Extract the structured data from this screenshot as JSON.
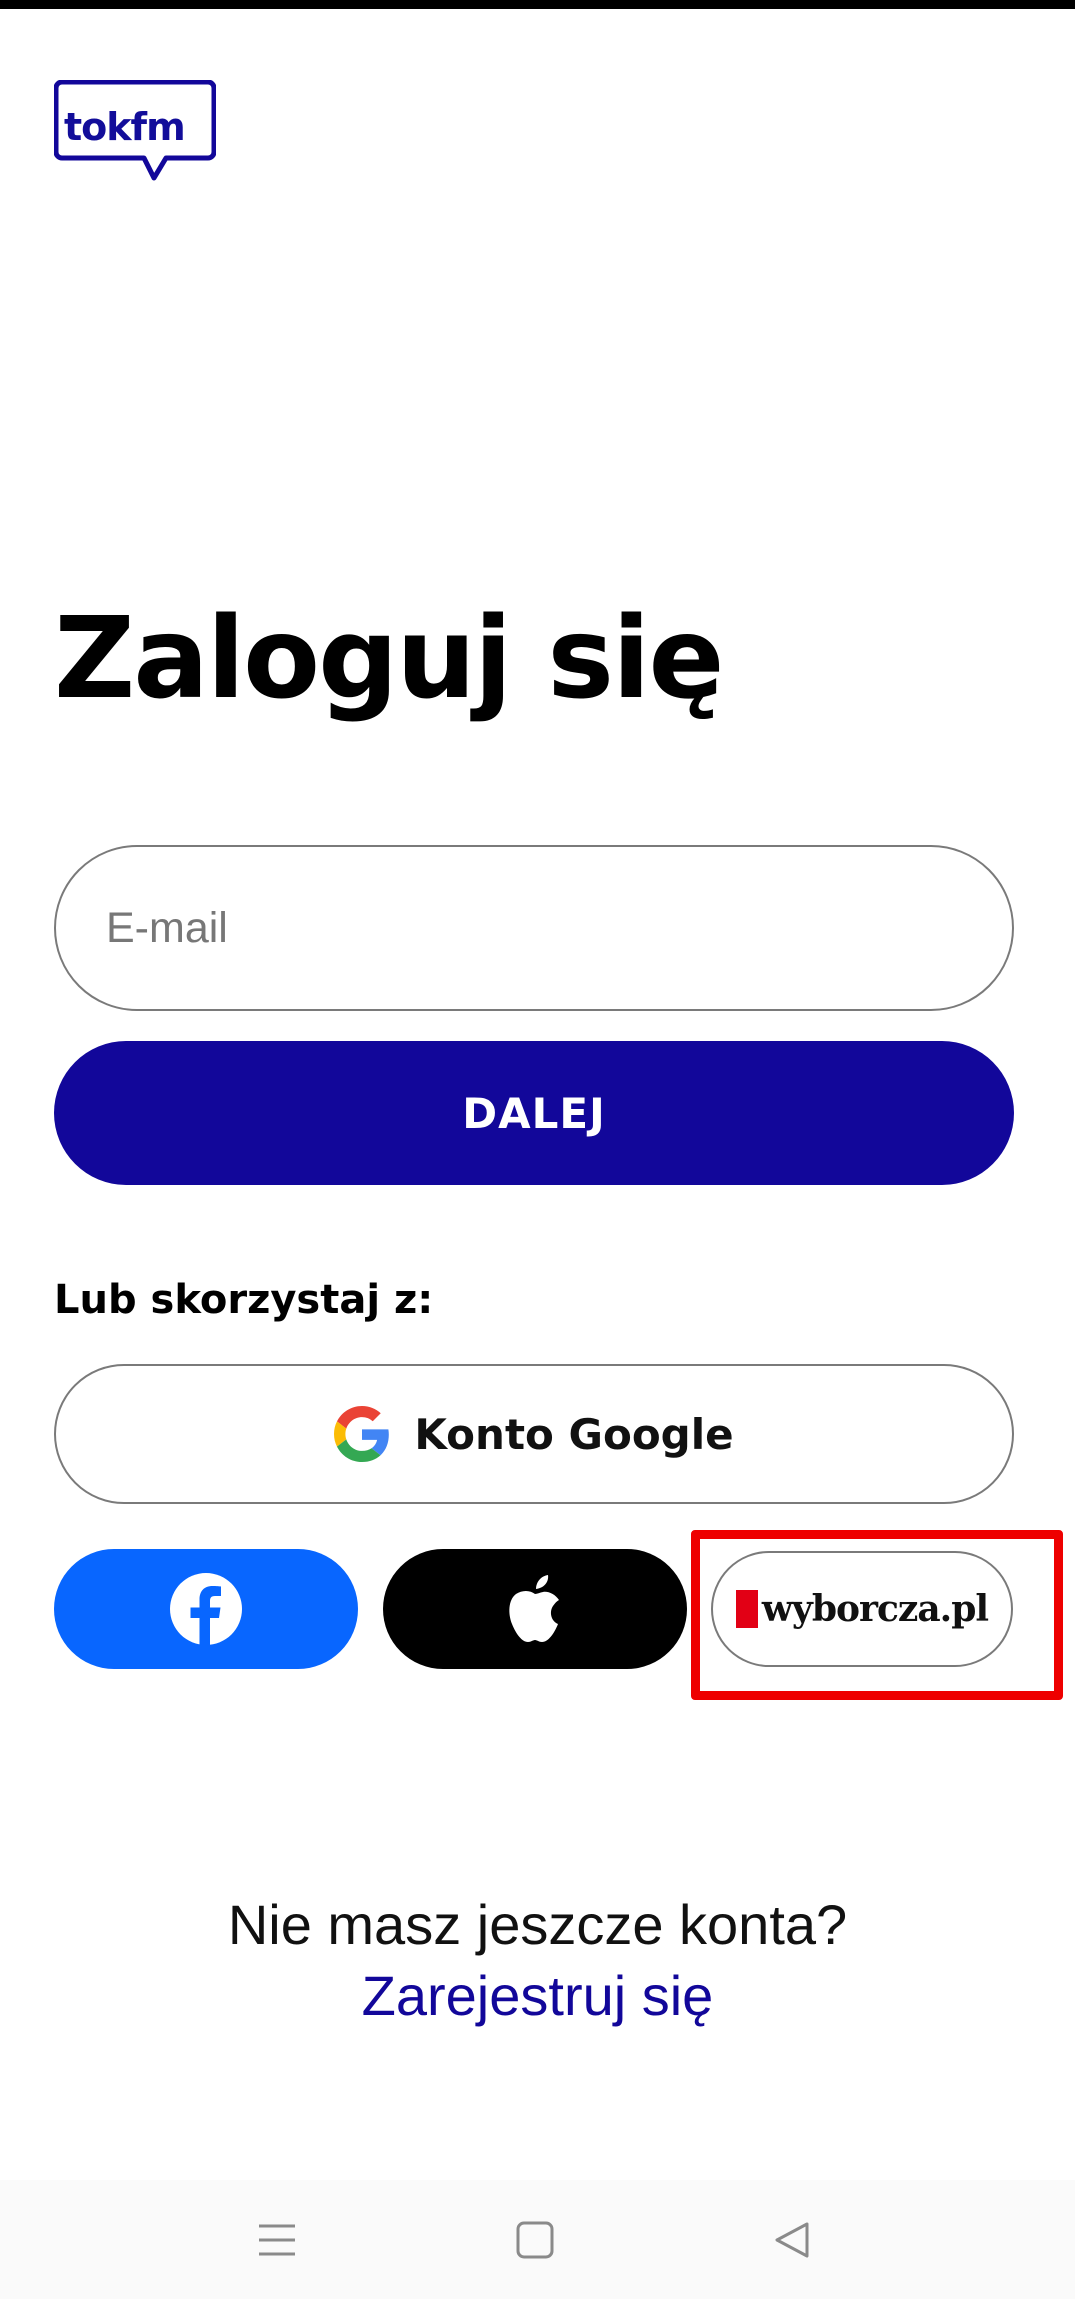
{
  "logo": {
    "text": "tokfm"
  },
  "page": {
    "title": "Zaloguj się"
  },
  "email": {
    "placeholder": "E-mail",
    "value": ""
  },
  "primary_button": {
    "label": "DALEJ"
  },
  "alternatives": {
    "label": "Lub skorzystaj z:",
    "google_label": "Konto Google",
    "wyborcza_label": "wyborcza.pl"
  },
  "signup": {
    "question": "Nie masz jeszcze konta?",
    "link": "Zarejestruj się"
  },
  "icons": {
    "google": "google-icon",
    "facebook": "facebook-icon",
    "apple": "apple-icon",
    "nav_menu": "menu-icon",
    "nav_home": "home-icon",
    "nav_back": "back-icon"
  },
  "colors": {
    "brand": "#12079a",
    "facebook": "#0866ff",
    "apple": "#000000",
    "highlight": "#ee0000",
    "wyborcza_red": "#e20015"
  }
}
